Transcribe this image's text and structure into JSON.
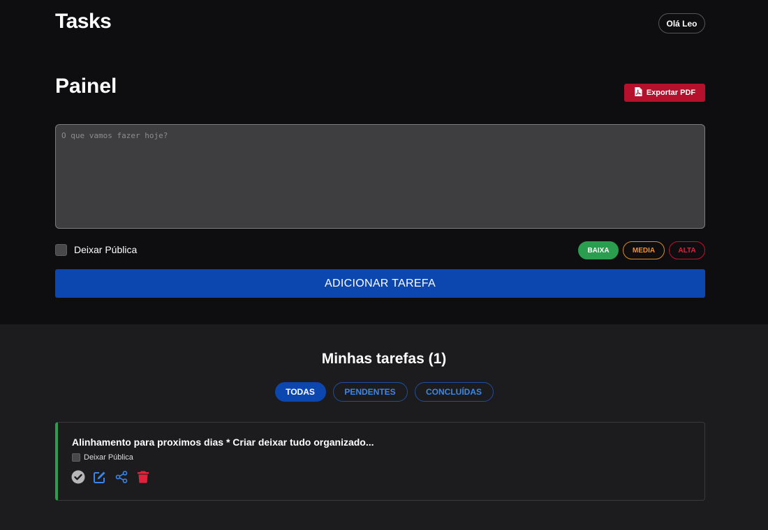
{
  "header": {
    "app_title": "Tasks",
    "user_greeting": "Olá Leo"
  },
  "panel": {
    "title": "Painel",
    "export_label": "Exportar PDF",
    "input_placeholder": "O que vamos fazer hoje?",
    "input_value": "",
    "public_label": "Deixar Pública",
    "public_checked": false,
    "priorities": {
      "low": "BAIXA",
      "medium": "MEDIA",
      "high": "ALTA",
      "selected": "low"
    },
    "add_label": "ADICIONAR TAREFA"
  },
  "tasks_section": {
    "title": "Minhas tarefas (1)",
    "filters": {
      "all": "TODAS",
      "pending": "PENDENTES",
      "done": "CONCLUÍDAS",
      "active": "all"
    },
    "items": [
      {
        "text": "Alinhamento para proximos dias * Criar deixar tudo organizado...",
        "public_label": "Deixar Pública",
        "public_checked": false,
        "priority_color": "#2a9d4f"
      }
    ]
  },
  "colors": {
    "accent_blue": "#0c47b0",
    "danger_red": "#b5102c",
    "success_green": "#2a9d4f",
    "warning_orange": "#e08a1e",
    "link_blue": "#3c86e8",
    "delete_red": "#e0223d"
  },
  "icons": {
    "export": "file-pdf-icon",
    "complete": "check-circle-icon",
    "edit": "edit-icon",
    "share": "share-icon",
    "delete": "trash-icon"
  }
}
